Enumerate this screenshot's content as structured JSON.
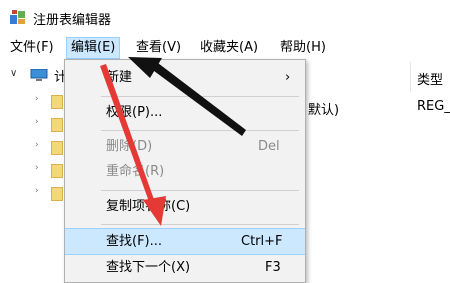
{
  "window": {
    "title": "注册表编辑器",
    "icon": "regedit-icon"
  },
  "menubar": {
    "items": [
      {
        "label": "文件(F)"
      },
      {
        "label": "编辑(E)"
      },
      {
        "label": "查看(V)"
      },
      {
        "label": "收藏夹(A)"
      },
      {
        "label": "帮助(H)"
      }
    ]
  },
  "tree": {
    "root_label_partial": "计",
    "root_icon": "computer-icon"
  },
  "values": {
    "type_header": "类型",
    "default_name": "默认)",
    "default_type": "REG_"
  },
  "edit_menu": {
    "items": [
      {
        "label": "新建",
        "shortcut": "",
        "submenu_arrow": "›"
      },
      {
        "label": "权限(P)...",
        "shortcut": ""
      },
      {
        "label": "删除(D)",
        "shortcut": "Del"
      },
      {
        "label": "重命名(R)",
        "shortcut": ""
      },
      {
        "label": "复制项名称(C)",
        "shortcut": ""
      },
      {
        "label": "查找(F)...",
        "shortcut": "Ctrl+F"
      },
      {
        "label": "查找下一个(X)",
        "shortcut": "F3"
      }
    ]
  },
  "annotations": {
    "arrow_color": "#e53935",
    "pointer_arrow_color": "#111111"
  }
}
